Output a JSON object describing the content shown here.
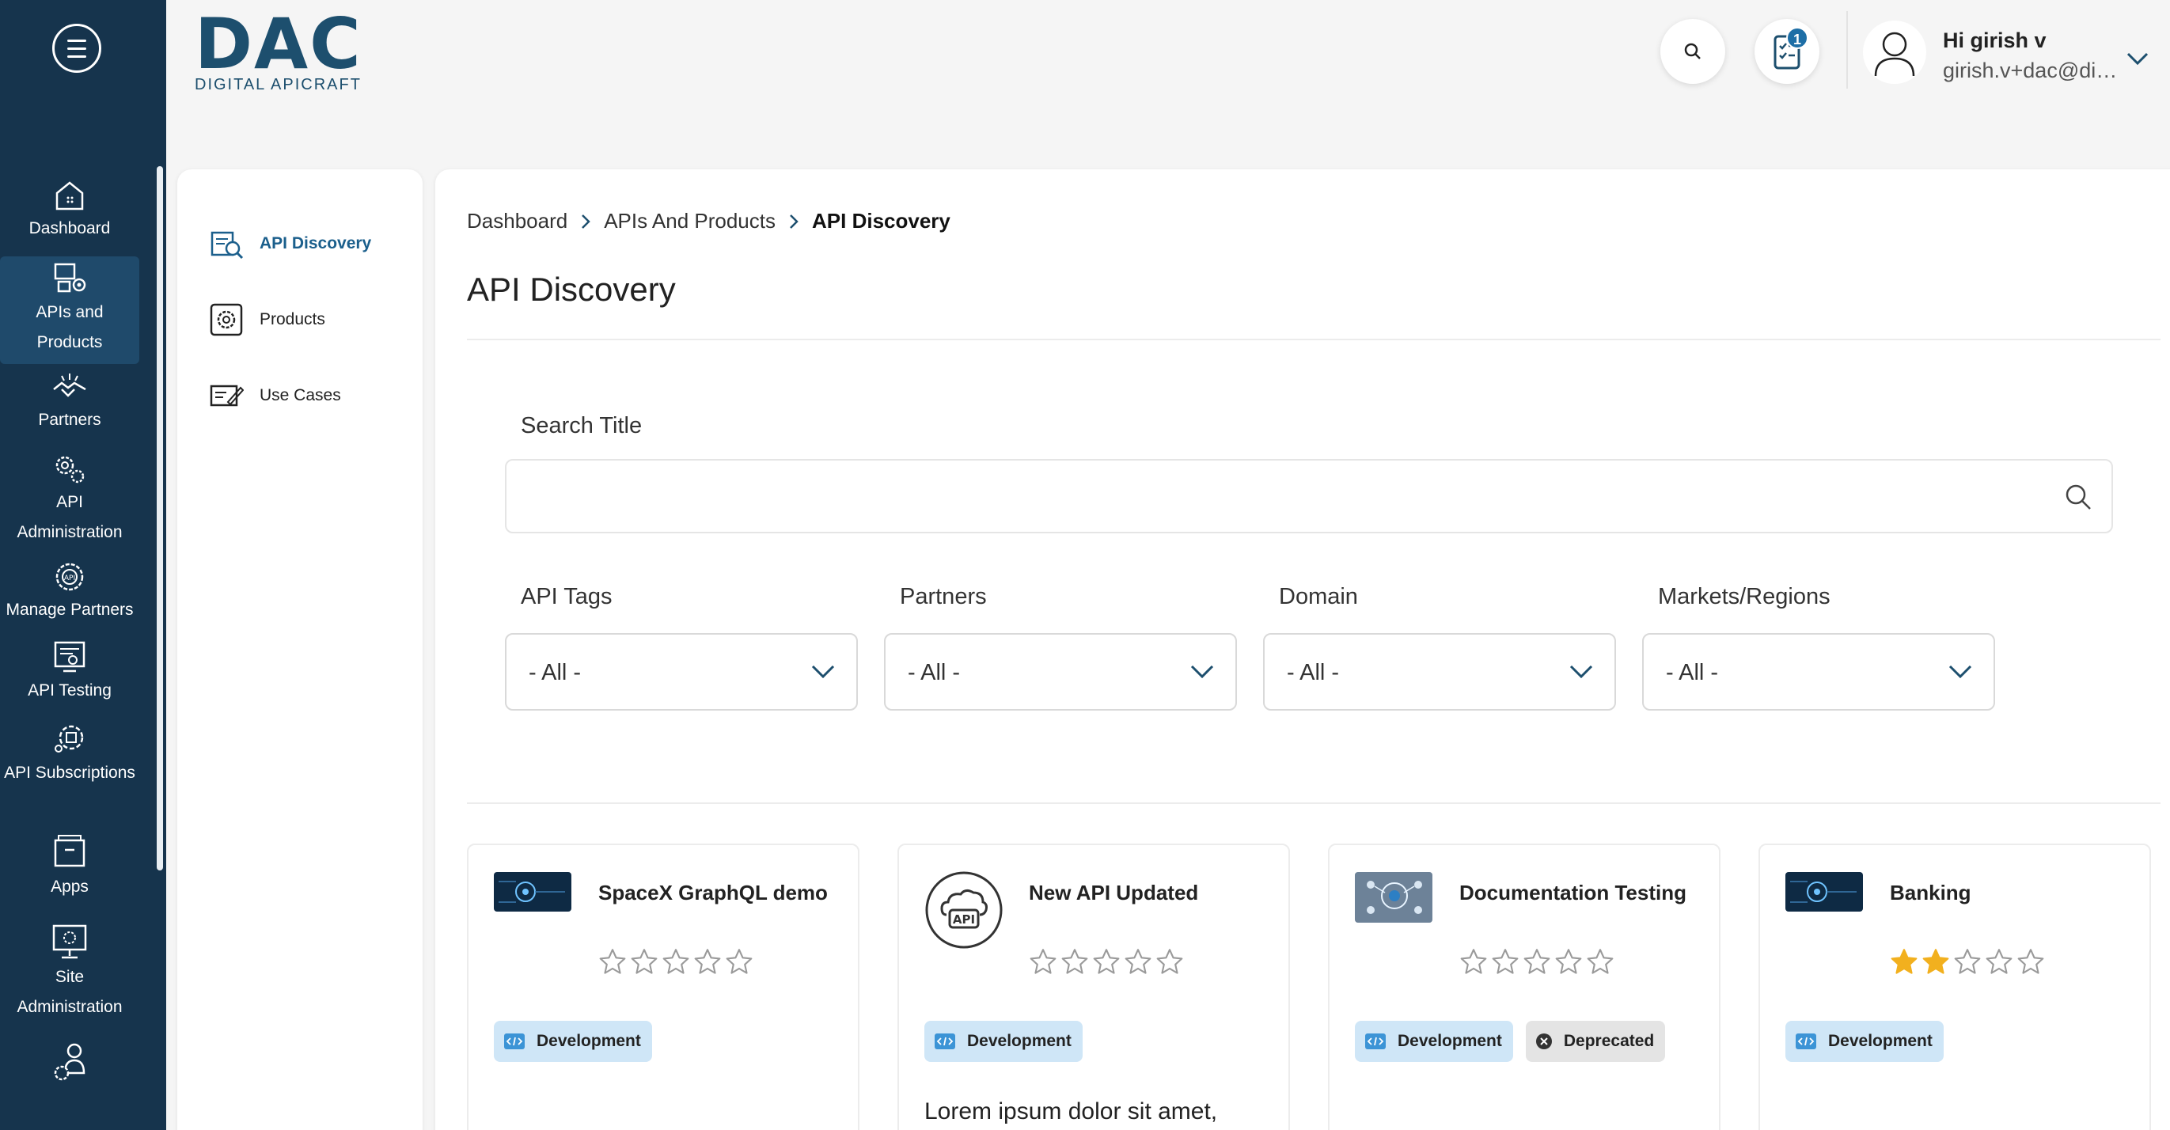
{
  "nav": {
    "items": [
      {
        "label": "Dashboard",
        "icon": "home-icon"
      },
      {
        "label": "APIs and Products",
        "icon": "api-products-icon"
      },
      {
        "label": "Partners",
        "icon": "handshake-icon"
      },
      {
        "label": "API Administration",
        "icon": "gears-icon"
      },
      {
        "label": "Manage Partners",
        "icon": "api-gear-icon"
      },
      {
        "label": "API Testing",
        "icon": "api-testing-icon"
      },
      {
        "label": "API Subscriptions",
        "icon": "subscriptions-icon"
      },
      {
        "label": "Apps",
        "icon": "apps-icon"
      },
      {
        "label": "Site Administration",
        "icon": "site-admin-icon"
      }
    ],
    "active": "APIs and Products"
  },
  "header": {
    "logo_main": "DAC",
    "logo_sub": "DIGITAL APICRAFT",
    "notification_count": "1",
    "greeting": "Hi girish v",
    "email": "girish.v+dac@digitalapicraft.com"
  },
  "subnav": {
    "items": [
      {
        "label": "API Discovery",
        "icon": "api-discovery-icon"
      },
      {
        "label": "Products",
        "icon": "products-icon"
      },
      {
        "label": "Use Cases",
        "icon": "use-cases-icon"
      }
    ],
    "active": "API Discovery"
  },
  "breadcrumb": [
    "Dashboard",
    "APIs And Products",
    "API Discovery"
  ],
  "page_title": "API Discovery",
  "search": {
    "label": "Search Title",
    "value": "",
    "placeholder": ""
  },
  "filters": [
    {
      "label": "API Tags",
      "value": "- All -"
    },
    {
      "label": "Partners",
      "value": "- All -"
    },
    {
      "label": "Domain",
      "value": "- All -"
    },
    {
      "label": "Markets/Regions",
      "value": "- All -"
    }
  ],
  "cards": [
    {
      "title": "SpaceX GraphQL demo",
      "rating": 0,
      "max_rating": 5,
      "tags": [
        "Development"
      ],
      "thumb": "circuit-image"
    },
    {
      "title": "New API Updated",
      "rating": 0,
      "max_rating": 5,
      "tags": [
        "Development"
      ],
      "thumb": "api-cloud-icon",
      "description": "Lorem ipsum dolor sit amet,"
    },
    {
      "title": "Documentation Testing",
      "rating": 0,
      "max_rating": 5,
      "tags": [
        "Development",
        "Deprecated"
      ],
      "thumb": "network-image"
    },
    {
      "title": "Banking",
      "rating": 2,
      "max_rating": 5,
      "tags": [
        "Development"
      ],
      "thumb": "circuit-image"
    }
  ],
  "colors": {
    "sidebar": "#16344d",
    "accent": "#1b5f8c",
    "star_filled": "#f2b01e",
    "tag_dev": "#cfe6f7",
    "tag_deprecated": "#e4e4e4"
  }
}
